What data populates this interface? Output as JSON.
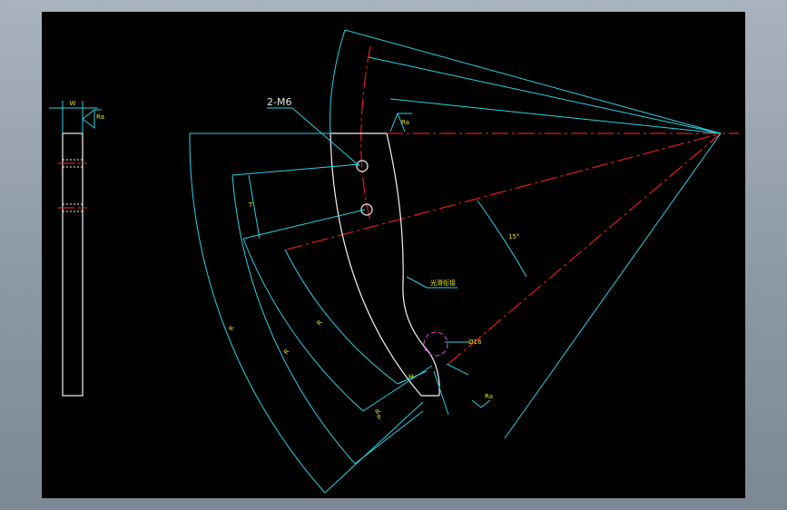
{
  "drawing": {
    "callout_holes": "2-M6",
    "dim_small_width": "W",
    "roughness_top": "Ra",
    "roughness_mid": "Ra",
    "roughness_bottom": "Ra",
    "dia_label": "Ø16",
    "radius_label_1": "R",
    "radius_label_2": "R",
    "radius_label_3": "R",
    "radius_label_4": "R",
    "angle_label": "15°",
    "note_label": "光滑衔接",
    "dim_t": "T",
    "dim_p": "P",
    "dim_h": "H"
  },
  "colors": {
    "background": "#000000",
    "dimension": "#27d3e6",
    "centerline": "#e21b1b",
    "outline": "#f4f4f4",
    "text": "#e6e600"
  }
}
